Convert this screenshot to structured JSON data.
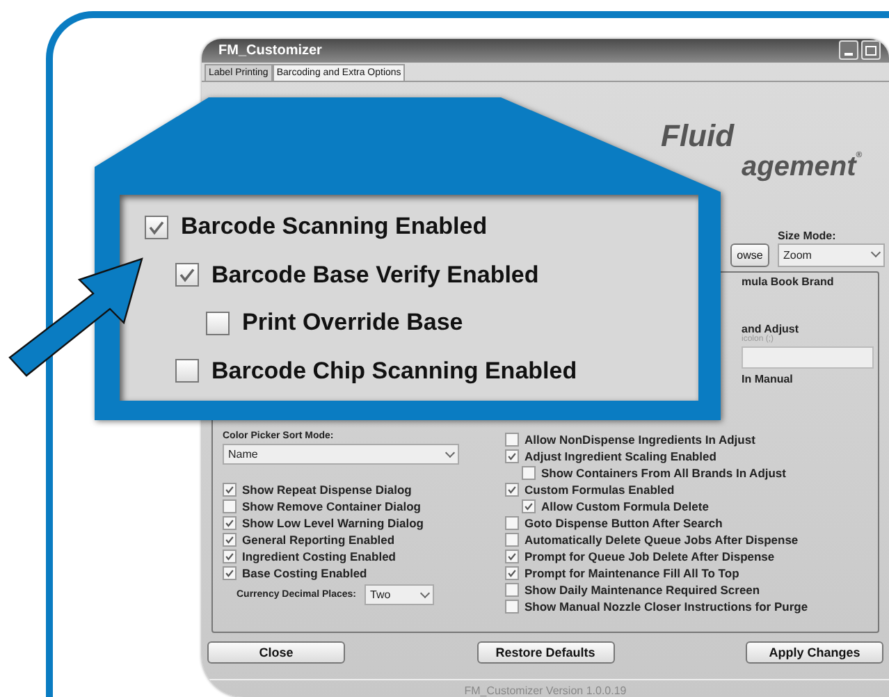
{
  "window": {
    "title": "FM_Customizer"
  },
  "tabs": [
    {
      "label": "Label Printing",
      "selected": false
    },
    {
      "label": "Barcoding and Extra Options",
      "selected": true
    }
  ],
  "logo": {
    "line_1": "Fluid",
    "line_2": "agement",
    "mark": "®"
  },
  "browse_button": {
    "label": "owse"
  },
  "size_mode": {
    "label": "Size Mode:",
    "value": "Zoom"
  },
  "right_panel": {
    "brand_label": "mula Book Brand",
    "adjust_label": "and Adjust",
    "hint": "icolon (;)",
    "manual_label": "In Manual"
  },
  "color_picker": {
    "label": "Color Picker Sort Mode:",
    "value": "Name"
  },
  "left_options": [
    {
      "label": "Show Repeat Dispense Dialog",
      "checked": true
    },
    {
      "label": "Show Remove Container Dialog",
      "checked": false
    },
    {
      "label": "Show Low Level Warning Dialog",
      "checked": true
    },
    {
      "label": "General Reporting Enabled",
      "checked": true
    },
    {
      "label": "Ingredient Costing Enabled",
      "checked": true
    },
    {
      "label": "Base Costing Enabled",
      "checked": true
    }
  ],
  "currency": {
    "label": "Currency Decimal Places:",
    "value": "Two"
  },
  "right_options": [
    {
      "label": "Allow NonDispense Ingredients In Adjust",
      "checked": false
    },
    {
      "label": "Adjust Ingredient Scaling Enabled",
      "checked": true,
      "children": [
        {
          "label": "Show Containers From All Brands In Adjust",
          "checked": false
        }
      ]
    },
    {
      "label": "Custom Formulas Enabled",
      "checked": true,
      "children": [
        {
          "label": "Allow Custom Formula Delete",
          "checked": true
        }
      ]
    },
    {
      "label": "Goto Dispense Button After Search",
      "checked": false
    },
    {
      "label": "Automatically Delete Queue Jobs After Dispense",
      "checked": false
    },
    {
      "label": "Prompt for Queue Job Delete After Dispense",
      "checked": true
    },
    {
      "label": "Prompt for Maintenance Fill All To Top",
      "checked": true
    },
    {
      "label": "Show Daily Maintenance Required Screen",
      "checked": false
    },
    {
      "label": "Show Manual Nozzle Closer Instructions for Purge",
      "checked": false
    }
  ],
  "buttons": [
    {
      "label": "Close"
    },
    {
      "label": "Restore Defaults"
    },
    {
      "label": "Apply Changes"
    }
  ],
  "status_bar": "FM_Customizer Version 1.0.0.19",
  "callout": {
    "items": [
      {
        "label": "Barcode Scanning Enabled",
        "checked": true,
        "children": [
          {
            "label": "Barcode Base Verify Enabled",
            "checked": true,
            "children": [
              {
                "label": "Print Override Base",
                "checked": false
              }
            ]
          },
          {
            "label": "Barcode Chip Scanning Enabled",
            "checked": false
          }
        ]
      }
    ]
  }
}
